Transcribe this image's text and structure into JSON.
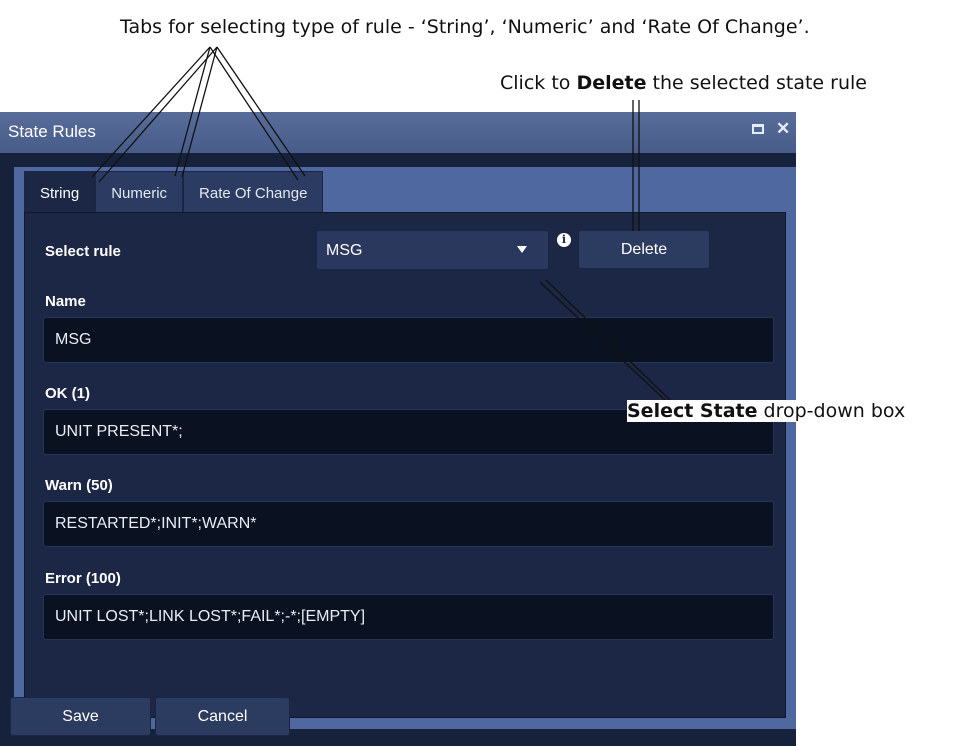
{
  "annotations": {
    "tabs_note": "Tabs for selecting type of rule - ‘String’, ‘Numeric’ and ‘Rate Of Change’.",
    "delete_prefix": "Click to ",
    "delete_bold": "Delete",
    "delete_suffix": " the selected state rule",
    "select_bold": "Select State",
    "select_suffix": " drop-down box"
  },
  "window": {
    "title": "State Rules",
    "maximize_icon": "maximize-icon",
    "close_glyph": "✕"
  },
  "tabs": [
    {
      "label": "String",
      "active": true
    },
    {
      "label": "Numeric",
      "active": false
    },
    {
      "label": "Rate Of Change",
      "active": false
    }
  ],
  "form": {
    "select_rule_label": "Select rule",
    "select_rule_value": "MSG",
    "info_glyph": "i",
    "delete_label": "Delete",
    "name_label": "Name",
    "name_value": "MSG",
    "ok_label": "OK (1)",
    "ok_value": "UNIT PRESENT*;",
    "warn_label": "Warn (50)",
    "warn_value": "RESTARTED*;INIT*;WARN*",
    "error_label": "Error (100)",
    "error_value": "UNIT LOST*;LINK LOST*;FAIL*;-*;[EMPTY]"
  },
  "footer": {
    "save_label": "Save",
    "cancel_label": "Cancel"
  },
  "colors": {
    "titlebar": "#4f6592",
    "panel_border": "#5068a0",
    "background": "#16223b",
    "field": "#0a1121"
  }
}
